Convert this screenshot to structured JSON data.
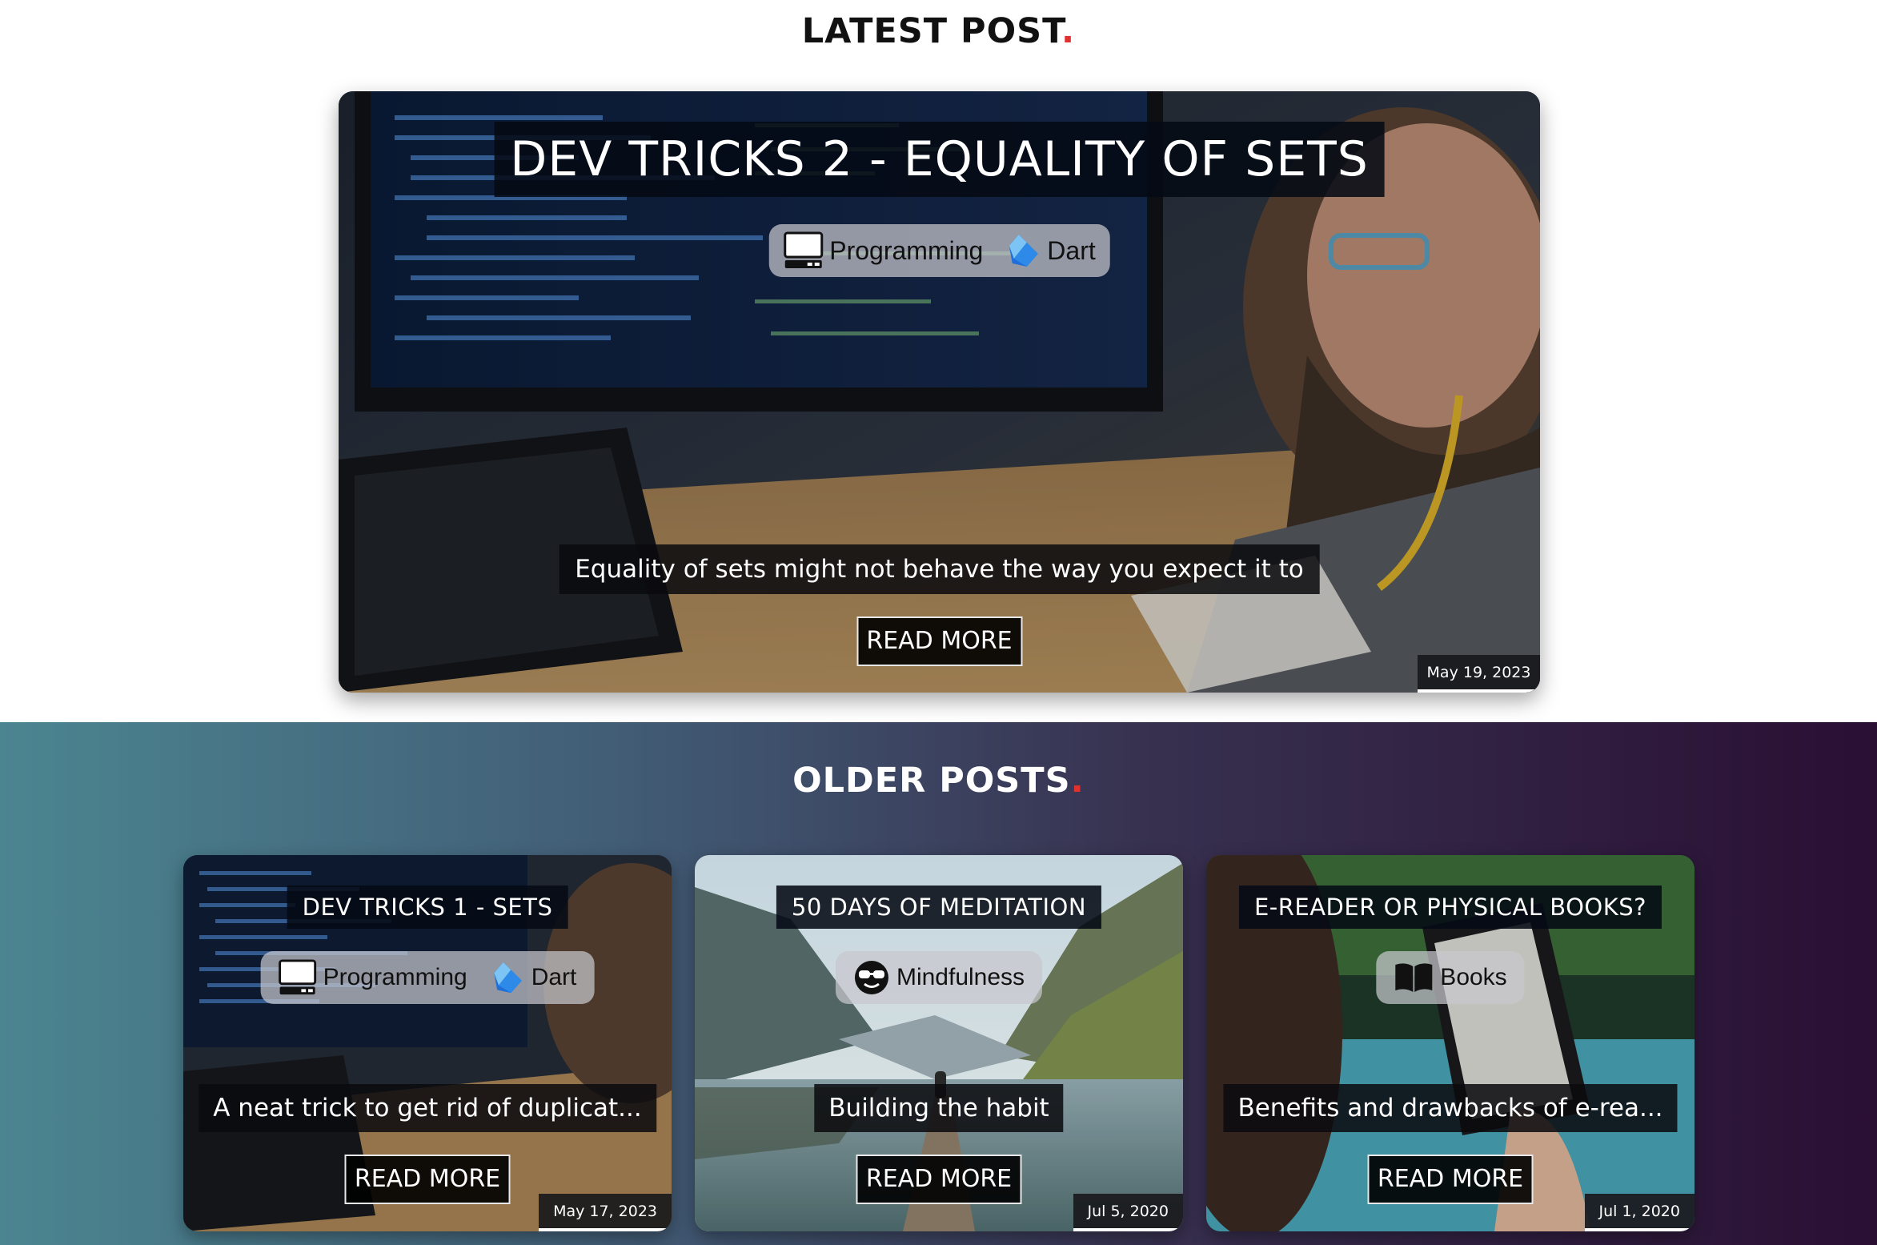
{
  "latest": {
    "heading": "LATEST POST",
    "heading_dot": ".",
    "post": {
      "title": "DEV TRICKS 2 - EQUALITY OF SETS",
      "tags": [
        {
          "label": "Programming",
          "icon": "computer-icon"
        },
        {
          "label": "Dart",
          "icon": "dart-icon"
        }
      ],
      "excerpt": "Equality of sets might not behave the way you expect it to",
      "read_more": "READ MORE",
      "date": "May 19, 2023"
    }
  },
  "older": {
    "heading": "OLDER POSTS",
    "heading_dot": ".",
    "posts": [
      {
        "title": "DEV TRICKS 1 - SETS",
        "tags": [
          {
            "label": "Programming",
            "icon": "computer-icon"
          },
          {
            "label": "Dart",
            "icon": "dart-icon"
          }
        ],
        "excerpt": "A neat trick to get rid of duplicat...",
        "read_more": "READ MORE",
        "date": "May 17, 2023"
      },
      {
        "title": "50 DAYS OF MEDITATION",
        "tags": [
          {
            "label": "Mindfulness",
            "icon": "sunglasses-face-icon"
          }
        ],
        "excerpt": "Building the habit",
        "read_more": "READ MORE",
        "date": "Jul 5, 2020"
      },
      {
        "title": "E-READER OR PHYSICAL BOOKS?",
        "tags": [
          {
            "label": "Books",
            "icon": "book-icon"
          }
        ],
        "excerpt": "Benefits and drawbacks of e-rea...",
        "read_more": "READ MORE",
        "date": "Jul 1, 2020"
      }
    ]
  },
  "colors": {
    "accent_dot": "#e03131",
    "gradient_start": "#4b8590",
    "gradient_end": "#2a0f33"
  }
}
